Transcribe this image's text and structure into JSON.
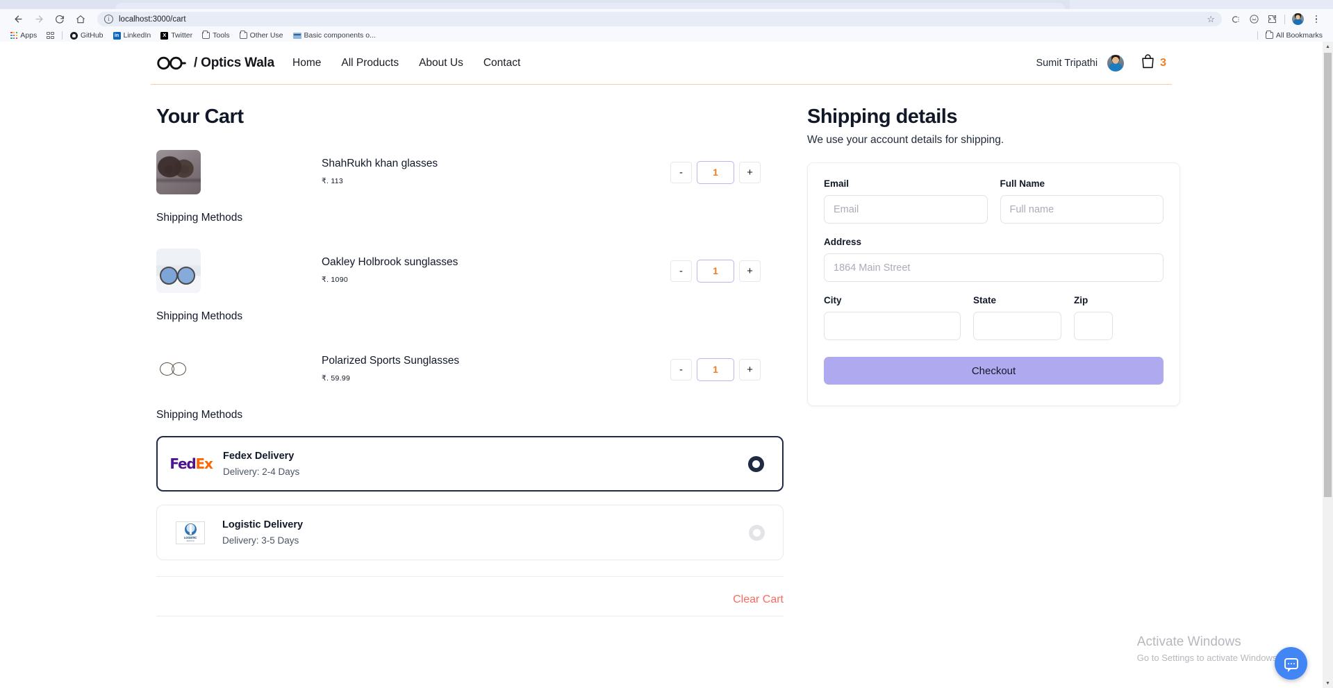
{
  "browser": {
    "back_icon": "back-arrow-icon",
    "forward_icon": "forward-arrow-icon",
    "reload_icon": "reload-icon",
    "home_icon": "home-icon",
    "url": "localhost:3000/cart",
    "site_info_glyph": "i",
    "star_glyph": "☆",
    "bookmarks": [
      {
        "label": "Apps",
        "icon": "apps-grid-icon"
      },
      {
        "label": "",
        "icon": "tab-search-icon"
      },
      {
        "label": "GitHub",
        "icon": "github-icon"
      },
      {
        "label": "LinkedIn",
        "icon": "linkedin-icon",
        "glyph": "in"
      },
      {
        "label": "Twitter",
        "icon": "twitter-x-icon",
        "glyph": "X"
      },
      {
        "label": "Tools",
        "icon": "folder-icon"
      },
      {
        "label": "Other Use",
        "icon": "folder-icon"
      },
      {
        "label": "Basic components o...",
        "icon": "bookmark-site-icon"
      }
    ],
    "all_bookmarks_label": "All Bookmarks"
  },
  "site": {
    "brand_name": "/ Optics Wala",
    "nav_links": [
      "Home",
      "All Products",
      "About Us",
      "Contact"
    ],
    "user_name": "Sumit Tripathi",
    "cart_count": "3"
  },
  "cart": {
    "title": "Your Cart",
    "shipping_methods_label": "Shipping Methods",
    "clear_cart_label": "Clear Cart",
    "minus_label": "-",
    "plus_label": "+",
    "items": [
      {
        "name": "ShahRukh khan glasses",
        "price": "₹. 113",
        "qty": "1"
      },
      {
        "name": "Oakley Holbrook sunglasses",
        "price": "₹. 1090",
        "qty": "1"
      },
      {
        "name": "Polarized Sports Sunglasses",
        "price": "₹. 59.99",
        "qty": "1"
      }
    ],
    "shipping_options": [
      {
        "logo": "fedex-logo",
        "logo_part1": "Fed",
        "logo_part2": "Ex",
        "title": "Fedex Delivery",
        "subtitle": "Delivery: 2-4 Days",
        "selected": true
      },
      {
        "logo": "logistic-logo",
        "logo_text": "LOGISTIC",
        "logo_subtext": "SERVICE",
        "title": "Logistic Delivery",
        "subtitle": "Delivery: 3-5 Days",
        "selected": false
      }
    ]
  },
  "shipping": {
    "title": "Shipping details",
    "subtitle": "We use your account details for shipping.",
    "fields": {
      "email": {
        "label": "Email",
        "placeholder": "Email",
        "value": ""
      },
      "full_name": {
        "label": "Full Name",
        "placeholder": "Full name",
        "value": ""
      },
      "address": {
        "label": "Address",
        "placeholder": "1864 Main Street",
        "value": ""
      },
      "city": {
        "label": "City",
        "placeholder": "",
        "value": ""
      },
      "state": {
        "label": "State",
        "placeholder": "",
        "value": ""
      },
      "zip": {
        "label": "Zip",
        "placeholder": "",
        "value": ""
      }
    },
    "checkout_label": "Checkout"
  },
  "watermark": {
    "line1": "Activate Windows",
    "line2": "Go to Settings to activate Windows."
  },
  "colors": {
    "accent_orange": "#f07c20",
    "nav_border": "#f6cba4",
    "checkout_purple": "#afaaf0",
    "clear_cart_red": "#fa6a63",
    "selected_card_border": "#1f2a44",
    "fedex_purple": "#4d148c",
    "fedex_orange": "#ff6600",
    "fab_blue": "#4285f4"
  }
}
